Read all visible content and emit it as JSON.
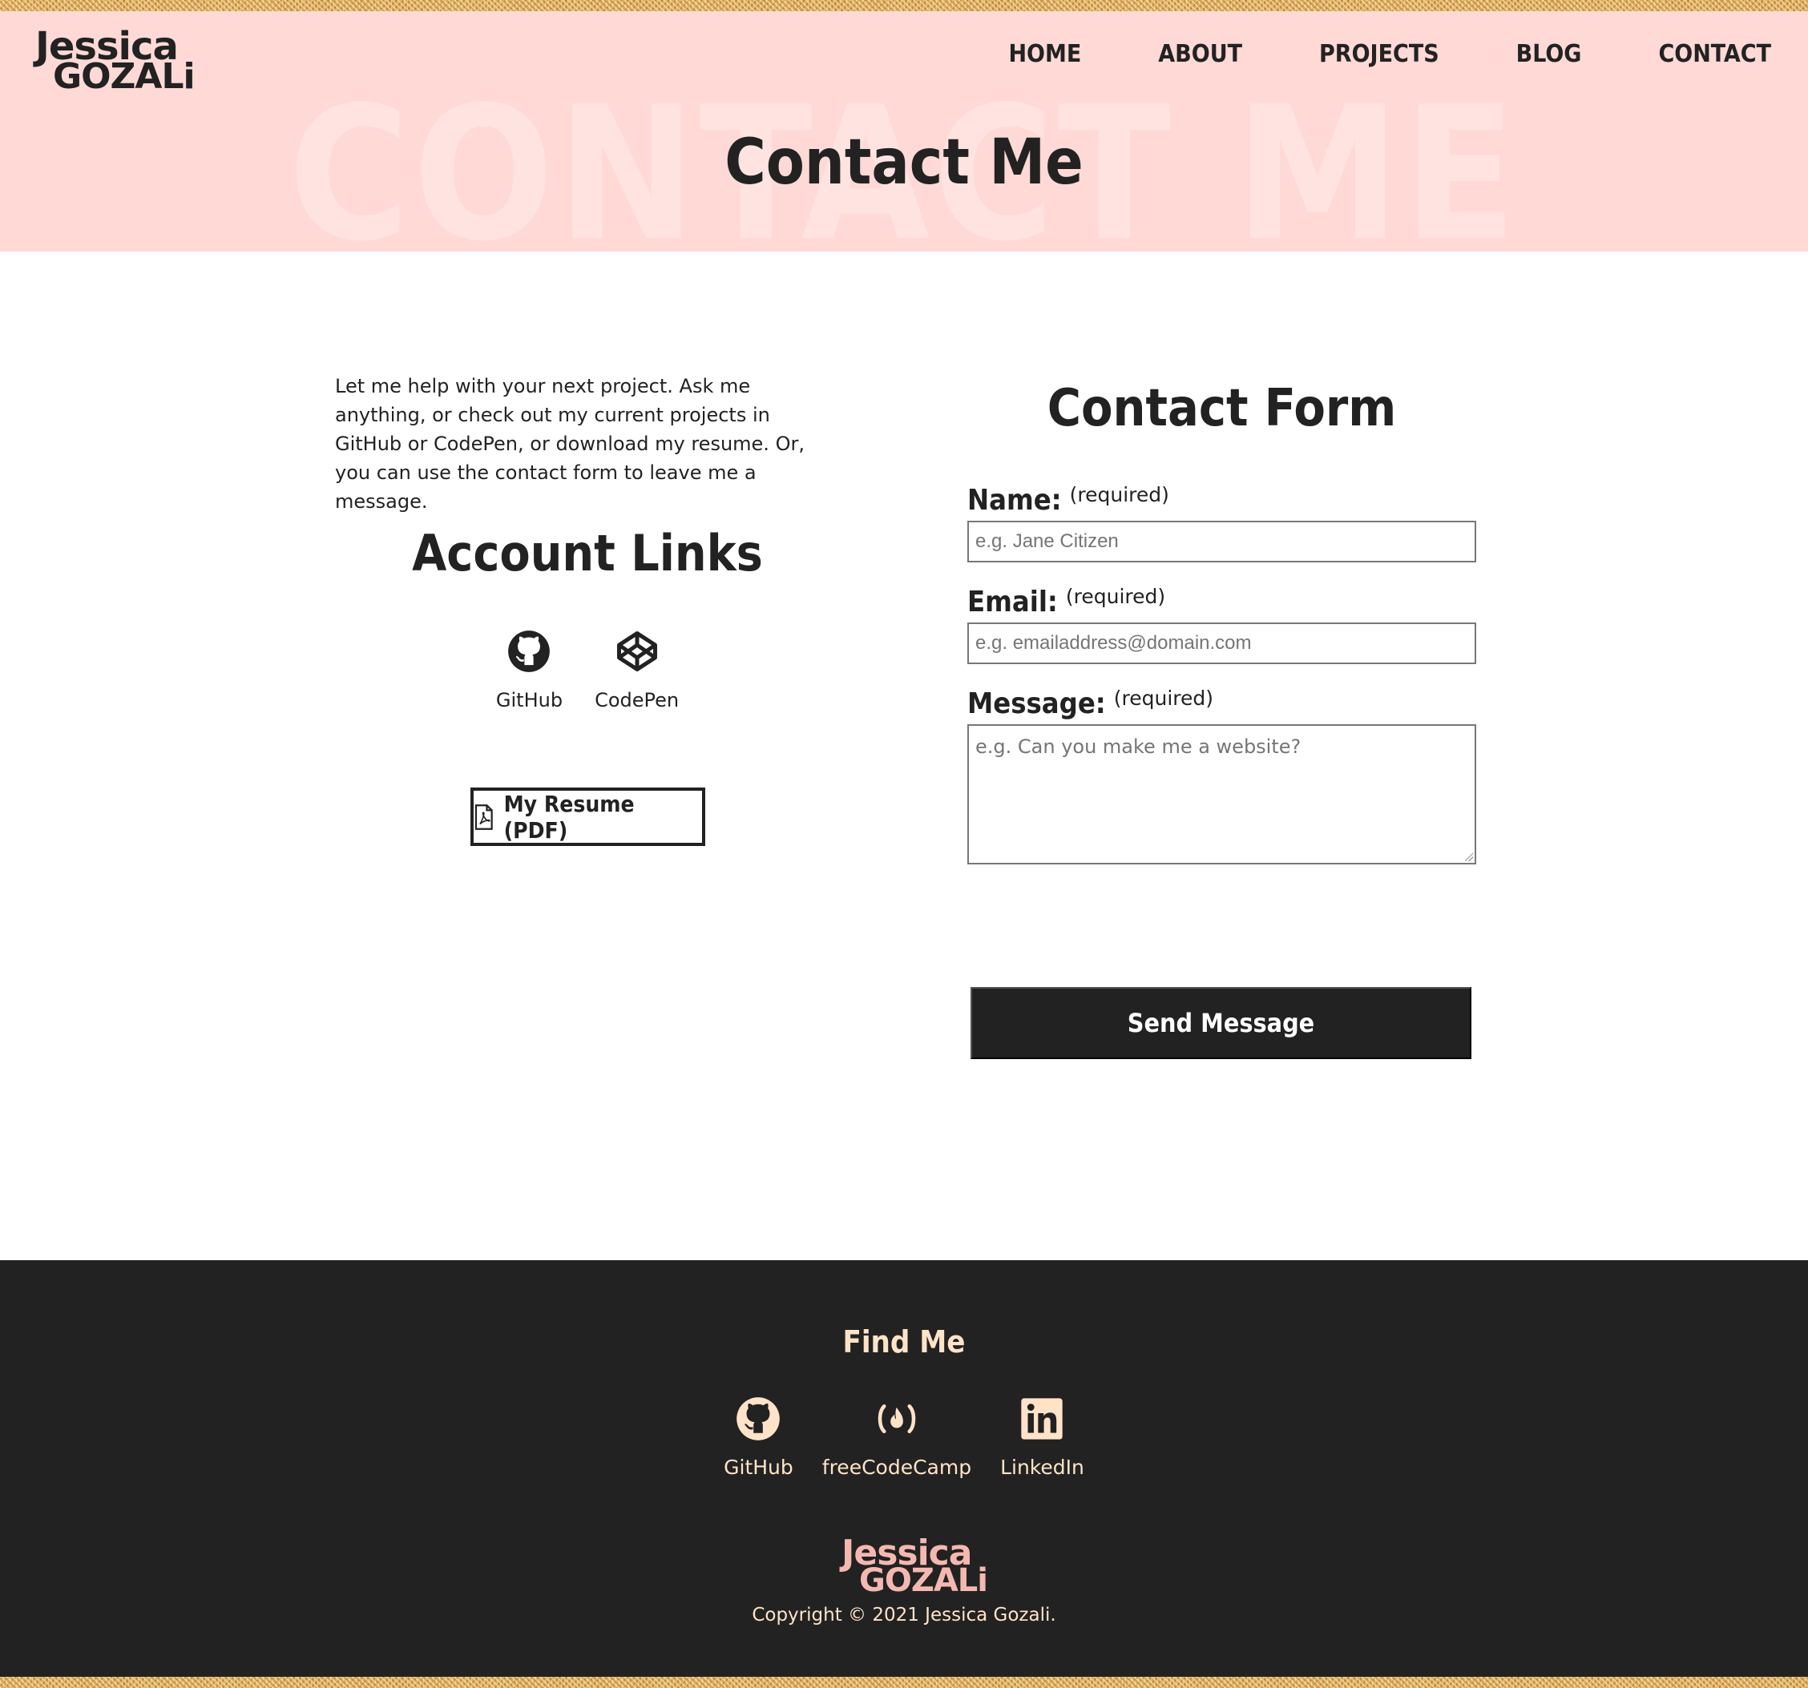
{
  "header": {
    "logo": {
      "line1": "Jessica",
      "line2": "GOZALi"
    },
    "nav": [
      "HOME",
      "ABOUT",
      "PROJECTS",
      "BLOG",
      "CONTACT"
    ],
    "hero_bg_text": "CONTACT ME",
    "title": "Contact Me"
  },
  "intro": "Let me help with your next project. Ask me anything, or check out my current projects in GitHub or CodePen, or download my resume. Or, you can use the contact form to leave me a message.",
  "account_links": {
    "title": "Account Links",
    "links": [
      {
        "label": "GitHub",
        "icon": "github-icon"
      },
      {
        "label": "CodePen",
        "icon": "codepen-icon"
      }
    ],
    "resume_button": "My Resume (PDF)"
  },
  "form": {
    "title": "Contact Form",
    "required_note": "(required)",
    "name": {
      "label": "Name:",
      "placeholder": "e.g. Jane Citizen"
    },
    "email": {
      "label": "Email:",
      "placeholder": "e.g. emailaddress@domain.com"
    },
    "message": {
      "label": "Message:",
      "placeholder": "e.g. Can you make me a website?"
    },
    "submit": "Send Message"
  },
  "footer": {
    "heading": "Find Me",
    "links": [
      {
        "label": "GitHub",
        "icon": "github-icon"
      },
      {
        "label": "freeCodeCamp",
        "icon": "freecodecamp-icon"
      },
      {
        "label": "LinkedIn",
        "icon": "linkedin-icon"
      }
    ],
    "logo": {
      "line1": "Jessica",
      "line2": "GOZALi"
    },
    "copyright": "Copyright © 2021 Jessica Gozali."
  },
  "colors": {
    "header_bg": "#ffd9d6",
    "dark": "#222222",
    "footer_text": "#ffe3c8",
    "footer_logo": "#f4b8b0",
    "glitter": "#d9a44c"
  }
}
